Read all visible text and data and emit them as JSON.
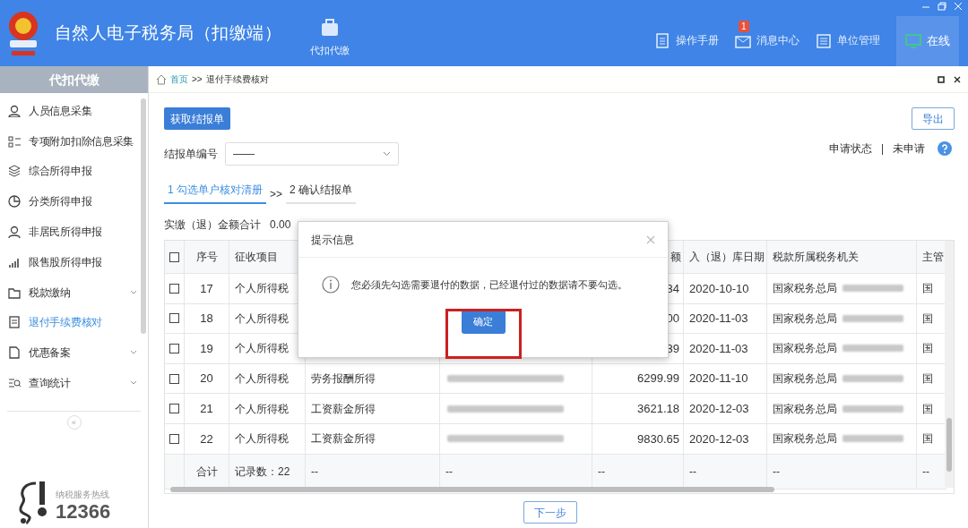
{
  "window": {
    "title": "自然人电子税务局（扣缴端）"
  },
  "top_nav": [
    {
      "label": "代扣代缴"
    }
  ],
  "header_links": [
    {
      "label": "操作手册"
    },
    {
      "label": "消息中心",
      "badge": "1"
    },
    {
      "label": "单位管理"
    }
  ],
  "status": {
    "label": "在线",
    "online": true
  },
  "sidebar": {
    "title": "代扣代缴",
    "items": [
      {
        "label": "人员信息采集",
        "selected": false,
        "expandable": false
      },
      {
        "label": "专项附加扣除信息采集",
        "selected": false,
        "expandable": false
      },
      {
        "label": "综合所得申报",
        "selected": false,
        "expandable": false
      },
      {
        "label": "分类所得申报",
        "selected": false,
        "expandable": false
      },
      {
        "label": "非居民所得申报",
        "selected": false,
        "expandable": false
      },
      {
        "label": "限售股所得申报",
        "selected": false,
        "expandable": false
      },
      {
        "label": "税款缴纳",
        "selected": false,
        "expandable": true
      },
      {
        "label": "退付手续费核对",
        "selected": true,
        "expandable": false
      },
      {
        "label": "优惠备案",
        "selected": false,
        "expandable": true
      },
      {
        "label": "查询统计",
        "selected": false,
        "expandable": true
      }
    ],
    "collapse": "«",
    "hotline": {
      "caption": "纳税服务热线",
      "number": "12366"
    }
  },
  "breadcrumb": {
    "home": "首页",
    "separator": ">>",
    "current": "退付手续费核对"
  },
  "toolbar": {
    "fetch_button": "获取结报单",
    "export_button": "导出"
  },
  "filter": {
    "label": "结报单编号",
    "value": "——"
  },
  "apply_status": {
    "label": "申请状态",
    "separator": "|",
    "value": "未申请"
  },
  "steps": [
    {
      "label": "1 勾选单户核对清册",
      "selected": true
    },
    {
      "label": "2 确认结报单",
      "selected": false
    }
  ],
  "step_separator": ">>",
  "total": {
    "label": "实缴（退）金额合计",
    "value": "0.00"
  },
  "table": {
    "header_checked": false,
    "columns": {
      "seq": "序号",
      "item": "征收项目",
      "amount": "额",
      "date": "入（退）库日期",
      "office": "税款所属税务机关",
      "authority": "主管"
    },
    "rows": [
      {
        "checked": false,
        "seq": "17",
        "item": "个人所得税",
        "amount": "34",
        "date": "2020-10-10",
        "office": "国家税务总局",
        "authority": "国"
      },
      {
        "checked": false,
        "seq": "18",
        "item": "个人所得税",
        "amount": "00",
        "date": "2020-11-03",
        "office": "国家税务总局",
        "authority": "国"
      },
      {
        "checked": false,
        "seq": "19",
        "item": "个人所得税",
        "amount": "39",
        "date": "2020-11-03",
        "office": "国家税务总局",
        "authority": "国"
      },
      {
        "checked": false,
        "seq": "20",
        "item": "个人所得税",
        "income": "劳务报酬所得",
        "id_blurred": true,
        "amount": "6299.99",
        "date": "2020-11-10",
        "office": "国家税务总局",
        "authority": "国"
      },
      {
        "checked": false,
        "seq": "21",
        "item": "个人所得税",
        "income": "工资薪金所得",
        "id_blurred": true,
        "amount": "3621.18",
        "date": "2020-12-03",
        "office": "国家税务总局",
        "authority": "国"
      },
      {
        "checked": false,
        "seq": "22",
        "item": "个人所得税",
        "income": "工资薪金所得",
        "id_blurred": true,
        "amount": "9830.65",
        "date": "2020-12-03",
        "office": "国家税务总局",
        "authority": "国"
      }
    ],
    "footer": {
      "label": "合计",
      "count": "记录数：22",
      "dashes": [
        "--",
        "--",
        "--",
        "--",
        "--",
        "--"
      ]
    }
  },
  "next_button": "下一步",
  "dialog": {
    "title": "提示信息",
    "message": "您必须先勾选需要退付的数据，已经退付过的数据请不要勾选。",
    "confirm": "确定",
    "highlighted": true
  }
}
